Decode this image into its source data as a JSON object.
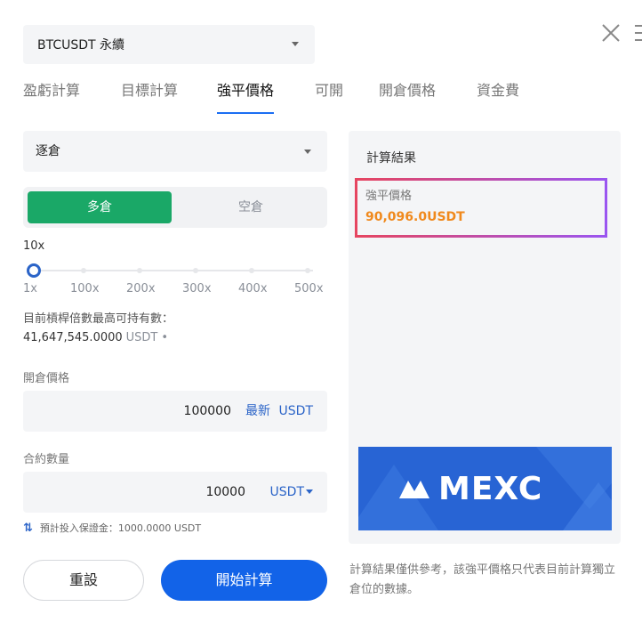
{
  "pair": {
    "label": "BTCUSDT 永續"
  },
  "tabs": [
    {
      "label": "盈虧計算",
      "active": false
    },
    {
      "label": "目標計算",
      "active": false
    },
    {
      "label": "強平價格",
      "active": true
    },
    {
      "label": "可開",
      "active": false
    },
    {
      "label": "開倉價格",
      "active": false
    },
    {
      "label": "資金費",
      "active": false
    }
  ],
  "margin_mode": {
    "selected": "逐倉"
  },
  "side": {
    "long_label": "多倉",
    "short_label": "空倉",
    "selected": "多倉"
  },
  "leverage": {
    "current": "10x",
    "marks": [
      "1x",
      "100x",
      "200x",
      "300x",
      "400x",
      "500x"
    ],
    "level_fraction": 0.0
  },
  "max_position": {
    "label": "目前槓桿倍數最高可持有數：",
    "value": "41,647,545.0000",
    "unit": "USDT"
  },
  "entry_price": {
    "label": "開倉價格",
    "value": "100000",
    "latest": "最新",
    "unit": "USDT"
  },
  "quantity": {
    "label": "合約數量",
    "value": "10000",
    "unit": "USDT"
  },
  "estimated_margin": {
    "text": "預計投入保證金：1000.0000 USDT"
  },
  "buttons": {
    "reset": "重設",
    "start": "開始計算"
  },
  "result": {
    "title": "計算結果",
    "liq_label": "強平價格",
    "liq_value": "90,096.0USDT"
  },
  "banner": {
    "brand": "MEXC"
  },
  "disclaimer": "計算結果僅供參考，該強平價格只代表目前計算獨立倉位的數據。",
  "colors": {
    "accent_blue": "#1263e8",
    "long_green": "#1aa867",
    "result_orange": "#f0891c",
    "highlight_red": "#e64560",
    "highlight_purple": "#9a55f0"
  }
}
